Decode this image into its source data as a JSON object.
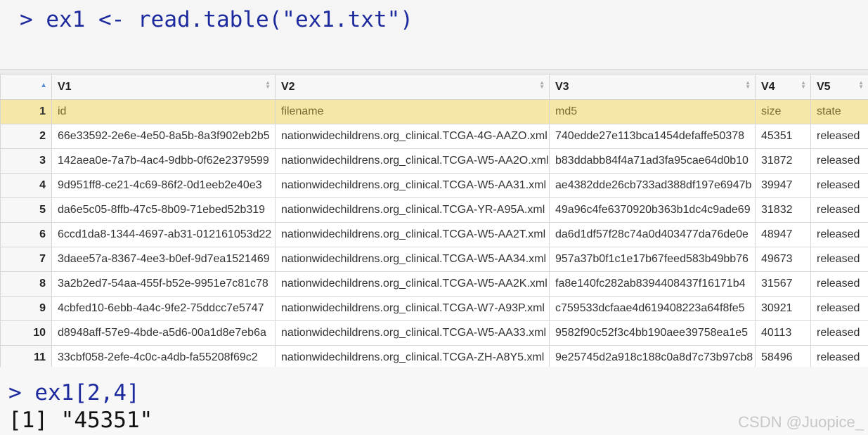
{
  "console": {
    "line1": {
      "prompt": ">",
      "command": "ex1 <- read.table(\"ex1.txt\")"
    },
    "line2": {
      "prompt": ">",
      "command": "ex1[2,4]"
    },
    "output": "[1] \"45351\""
  },
  "table": {
    "columns": [
      "V1",
      "V2",
      "V3",
      "V4",
      "V5"
    ],
    "rows": [
      {
        "n": "1",
        "cells": [
          "id",
          "filename",
          "md5",
          "size",
          "state"
        ]
      },
      {
        "n": "2",
        "cells": [
          "66e33592-2e6e-4e50-8a5b-8a3f902eb2b5",
          "nationwidechildrens.org_clinical.TCGA-4G-AAZO.xml",
          "740edde27e113bca1454defaffe50378",
          "45351",
          "released"
        ]
      },
      {
        "n": "3",
        "cells": [
          "142aea0e-7a7b-4ac4-9dbb-0f62e2379599",
          "nationwidechildrens.org_clinical.TCGA-W5-AA2O.xml",
          "b83ddabb84f4a71ad3fa95cae64d0b10",
          "31872",
          "released"
        ]
      },
      {
        "n": "4",
        "cells": [
          "9d951ff8-ce21-4c69-86f2-0d1eeb2e40e3",
          "nationwidechildrens.org_clinical.TCGA-W5-AA31.xml",
          "ae4382dde26cb733ad388df197e6947b",
          "39947",
          "released"
        ]
      },
      {
        "n": "5",
        "cells": [
          "da6e5c05-8ffb-47c5-8b09-71ebed52b319",
          "nationwidechildrens.org_clinical.TCGA-YR-A95A.xml",
          "49a96c4fe6370920b363b1dc4c9ade69",
          "31832",
          "released"
        ]
      },
      {
        "n": "6",
        "cells": [
          "6ccd1da8-1344-4697-ab31-012161053d22",
          "nationwidechildrens.org_clinical.TCGA-W5-AA2T.xml",
          "da6d1df57f28c74a0d403477da76de0e",
          "48947",
          "released"
        ]
      },
      {
        "n": "7",
        "cells": [
          "3daee57a-8367-4ee3-b0ef-9d7ea1521469",
          "nationwidechildrens.org_clinical.TCGA-W5-AA34.xml",
          "957a37b0f1c1e17b67feed583b49bb76",
          "49673",
          "released"
        ]
      },
      {
        "n": "8",
        "cells": [
          "3a2b2ed7-54aa-455f-b52e-9951e7c81c78",
          "nationwidechildrens.org_clinical.TCGA-W5-AA2K.xml",
          "fa8e140fc282ab8394408437f16171b4",
          "31567",
          "released"
        ]
      },
      {
        "n": "9",
        "cells": [
          "4cbfed10-6ebb-4a4c-9fe2-75ddcc7e5747",
          "nationwidechildrens.org_clinical.TCGA-W7-A93P.xml",
          "c759533dcfaae4d619408223a64f8fe5",
          "30921",
          "released"
        ]
      },
      {
        "n": "10",
        "cells": [
          "d8948aff-57e9-4bde-a5d6-00a1d8e7eb6a",
          "nationwidechildrens.org_clinical.TCGA-W5-AA33.xml",
          "9582f90c52f3c4bb190aee39758ea1e5",
          "40113",
          "released"
        ]
      },
      {
        "n": "11",
        "cells": [
          "33cbf058-2efe-4c0c-a4db-fa55208f69c2",
          "nationwidechildrens.org_clinical.TCGA-ZH-A8Y5.xml",
          "9e25745d2a918c188c0a8d7c73b97cb8",
          "58496",
          "released"
        ]
      }
    ]
  },
  "watermark": "CSDN @Juopice_",
  "icons": {
    "sort": "sort-arrows-icon",
    "sort_asc": "sort-ascending-icon"
  },
  "colors": {
    "prompt": "#1d2a9e",
    "highlight_row": "#f7e7a6"
  }
}
